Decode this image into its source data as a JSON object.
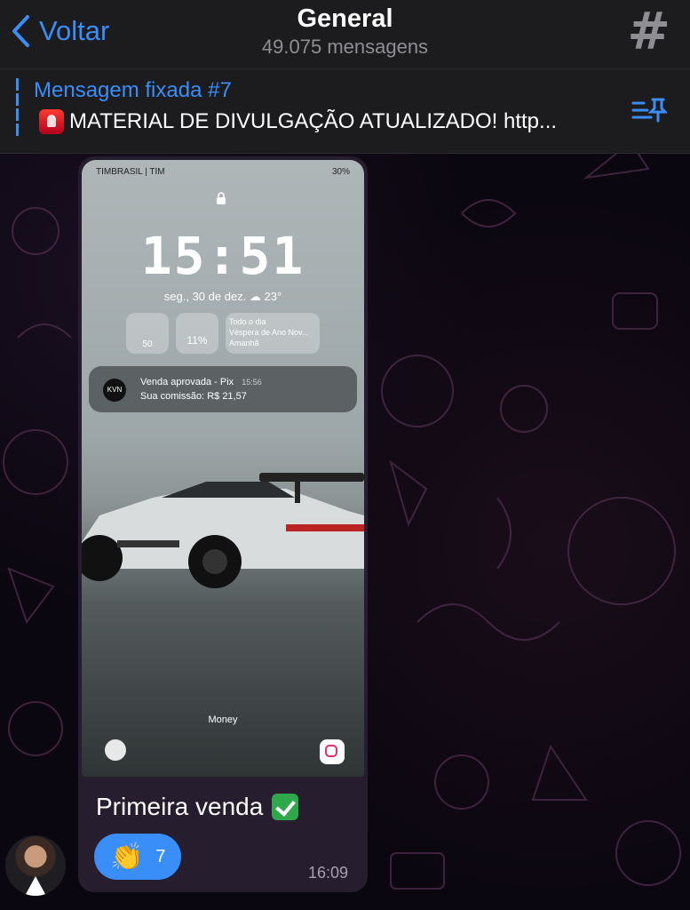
{
  "header": {
    "back_label": "Voltar",
    "title": "General",
    "subtitle": "49.075 mensagens",
    "channel_symbol": "#"
  },
  "pinned": {
    "title": "Mensagem fixada #7",
    "text": "MATERIAL DE DIVULGAÇÃO ATUALIZADO! http..."
  },
  "message": {
    "photo": {
      "status_left": "TIMBRASIL | TIM",
      "status_right": "30%",
      "clock": "15:51",
      "date": "seg., 30 de dez.",
      "temperature": "23°",
      "widget_steps": "50",
      "widget_battery": "11%",
      "widget_calendar": [
        "Todo o dia",
        "Véspera de Ano Nov...",
        "Amanhã"
      ],
      "notification_logo": "KVN",
      "notification_title": "Venda aprovada - Pix",
      "notification_time": "15:56",
      "notification_body": "Sua comissão: R$ 21,57",
      "money_label": "Money"
    },
    "caption": "Primeira venda",
    "reaction_emoji": "👏",
    "reaction_count": "7",
    "time": "16:09"
  },
  "colors": {
    "accent": "#3a8ef7",
    "header_bg": "#1c1c1e",
    "bubble_bg": "#261e2e"
  },
  "icons": [
    "chevron-left-icon",
    "hash-icon",
    "siren-icon",
    "pin-list-icon",
    "check-icon",
    "clap-icon",
    "lock-icon",
    "phone-icon",
    "camera-icon"
  ]
}
